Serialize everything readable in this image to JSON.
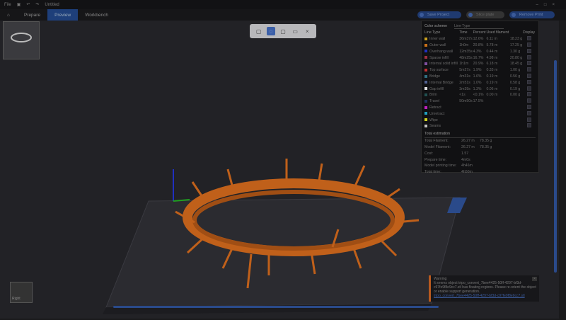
{
  "titlebar": {
    "file": "File",
    "project": "Untitled"
  },
  "tabs": [
    {
      "label": "Prepare"
    },
    {
      "label": "Preview"
    },
    {
      "label": "Workbench"
    }
  ],
  "actions": {
    "save_project": "Save Project",
    "slice_plate": "Slice plate",
    "print_plate": "Remove Print"
  },
  "legend": {
    "title": "Color scheme",
    "scheme": "Line Type",
    "headers": [
      "Line Type",
      "Time",
      "Percent",
      "Used filament",
      "Display"
    ],
    "rows": [
      {
        "name": "Inner wall",
        "color": "#c8a020",
        "time": "36m37s",
        "pct": "12.6%",
        "len": "6.11 m",
        "wt": "18.23 g"
      },
      {
        "name": "Outer wall",
        "color": "#c87018",
        "time": "1h0m",
        "pct": "20.8%",
        "len": "5.78 m",
        "wt": "17.25 g"
      },
      {
        "name": "Overhang wall",
        "color": "#2030c0",
        "time": "12m35s",
        "pct": "4.3%",
        "len": "0.44 m",
        "wt": "1.30 g"
      },
      {
        "name": "Sparse infill",
        "color": "#a03040",
        "time": "48m25s",
        "pct": "16.7%",
        "len": "4.98 m",
        "wt": "20.80 g"
      },
      {
        "name": "Internal solid infill",
        "color": "#8050a0",
        "time": "1h1m",
        "pct": "20.9%",
        "len": "6.18 m",
        "wt": "18.45 g"
      },
      {
        "name": "Top surface",
        "color": "#c03030",
        "time": "5m27s",
        "pct": "1.9%",
        "len": "0.33 m",
        "wt": "1.00 g"
      },
      {
        "name": "Bridge",
        "color": "#307080",
        "time": "4m31s",
        "pct": "1.6%",
        "len": "0.19 m",
        "wt": "0.56 g"
      },
      {
        "name": "Internal Bridge",
        "color": "#506090",
        "time": "2m51s",
        "pct": "1.0%",
        "len": "0.19 m",
        "wt": "0.58 g"
      },
      {
        "name": "Gap infill",
        "color": "#e0e0e0",
        "time": "3m39s",
        "pct": "1.3%",
        "len": "0.06 m",
        "wt": "0.19 g"
      },
      {
        "name": "Brim",
        "color": "#205050",
        "time": "<1s",
        "pct": "<0.1%",
        "len": "0.00 m",
        "wt": "0.00 g"
      },
      {
        "name": "Travel",
        "color": "#203060",
        "time": "50m50s",
        "pct": "17.5%",
        "len": "",
        "wt": ""
      },
      {
        "name": "Retract",
        "color": "#c020c0",
        "time": "",
        "pct": "",
        "len": "",
        "wt": ""
      },
      {
        "name": "Unretract",
        "color": "#20a0c0",
        "time": "",
        "pct": "",
        "len": "",
        "wt": ""
      },
      {
        "name": "Wipe",
        "color": "#d0d020",
        "time": "",
        "pct": "",
        "len": "",
        "wt": ""
      },
      {
        "name": "Seams",
        "color": "#c0c0c0",
        "time": "",
        "pct": "",
        "len": "",
        "wt": ""
      }
    ],
    "total_title": "Total estimation",
    "totals": [
      {
        "label": "Total Filament:",
        "v1": "26.27 m",
        "v2": "78.35 g"
      },
      {
        "label": "Model Filament:",
        "v1": "26.27 m",
        "v2": "78.35 g"
      },
      {
        "label": "Cost:",
        "v1": "1.57",
        "v2": ""
      },
      {
        "label": "Prepare time:",
        "v1": "4m0s",
        "v2": ""
      },
      {
        "label": "Model printing time:",
        "v1": "4h46m",
        "v2": ""
      },
      {
        "label": "Total time:",
        "v1": "4h50m",
        "v2": ""
      }
    ]
  },
  "warning": {
    "title": "Warning",
    "text": "It seems object tripo_convert_7bee4425-50ff-4297-bf3d-c97fe9f8e9cc7.stl has floating regions. Please re-orient the object or enable support generation.",
    "link": "tripo_convert_7bee4425-50ff-4297-bf3d-c97fe9f8e9cc7.stl"
  },
  "navcube": {
    "label": "Right"
  }
}
